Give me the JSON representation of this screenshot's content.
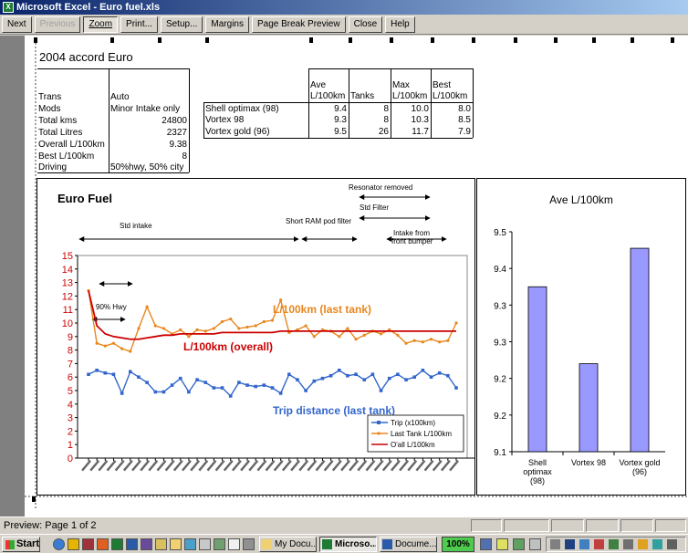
{
  "window": {
    "title": "Microsoft Excel - Euro fuel.xls"
  },
  "toolbar": {
    "next": "Next",
    "previous": "Previous",
    "zoom": "Zoom",
    "print": "Print...",
    "setup": "Setup...",
    "margins": "Margins",
    "page_break": "Page Break Preview",
    "close": "Close",
    "help": "Help"
  },
  "sheet": {
    "title": "2004 accord Euro",
    "info_rows": [
      {
        "label": "Trans",
        "value": "Auto"
      },
      {
        "label": "Mods",
        "value": "Minor Intake only"
      },
      {
        "label": "Total kms",
        "value": "24800"
      },
      {
        "label": "Total Litres",
        "value": "2327"
      },
      {
        "label": "Overall L/100km",
        "value": "9.38"
      },
      {
        "label": "Best L/100km",
        "value": "8"
      },
      {
        "label": "Driving",
        "value": "50%hwy, 50% city"
      }
    ],
    "fuel_table": {
      "headers": {
        "ave_1": "Ave",
        "ave_2": "L/100km",
        "tanks": "Tanks",
        "max_1": "Max",
        "max_2": "L/100km",
        "best_1": "Best",
        "best_2": "L/100km"
      },
      "rows": [
        {
          "name": "Shell optimax (98)",
          "ave": "9.4",
          "tanks": "8",
          "max": "10.0",
          "best": "8.0"
        },
        {
          "name": "Vortex 98",
          "ave": "9.3",
          "tanks": "8",
          "max": "10.3",
          "best": "8.5"
        },
        {
          "name": "Vortex gold (96)",
          "ave": "9.5",
          "tanks": "26",
          "max": "11.7",
          "best": "7.9"
        }
      ]
    }
  },
  "line_chart_labels": {
    "title": "Euro Fuel",
    "resonator": "Resonator removed",
    "std_filter": "Std Filter",
    "std_intake": "Std intake",
    "short_ram": "Short RAM pod filter",
    "intake_bumper_1": "Intake from",
    "intake_bumper_2": "front bumper",
    "hwy": "90% Hwy",
    "last_tank_label": "L/100km (last tank)",
    "overall_label": "L/100km (overall)",
    "trip_label": "Trip distance (last tank)",
    "legend": [
      "Trip (x100km)",
      "Last Tank L/100km",
      "O'all L/100km"
    ]
  },
  "chart_data": [
    {
      "type": "line",
      "title": "Euro Fuel",
      "xlabel": "",
      "ylabel": "",
      "ylim": [
        0,
        15
      ],
      "yticks": [
        0,
        1,
        2,
        3,
        4,
        5,
        6,
        7,
        8,
        9,
        10,
        11,
        12,
        13,
        14,
        15
      ],
      "legend_position": "bottom-right",
      "series": [
        {
          "name": "Trip (x100km)",
          "color": "#3366cc",
          "values": [
            6.2,
            6.5,
            6.3,
            6.2,
            4.8,
            6.4,
            6.0,
            5.6,
            4.9,
            4.9,
            5.4,
            5.9,
            4.9,
            5.8,
            5.6,
            5.2,
            5.2,
            4.6,
            5.6,
            5.4,
            5.3,
            5.4,
            5.2,
            4.8,
            6.2,
            5.8,
            5.0,
            5.7,
            5.9,
            6.1,
            6.5,
            6.1,
            6.2,
            5.8,
            6.2,
            5.0,
            5.9,
            6.2,
            5.8,
            6.0,
            6.5,
            6.0,
            6.3,
            6.1,
            5.2
          ]
        },
        {
          "name": "Last Tank L/100km",
          "color": "#e8871e",
          "values": [
            12.4,
            8.5,
            8.3,
            8.5,
            8.1,
            7.9,
            9.6,
            11.2,
            9.8,
            9.6,
            9.2,
            9.5,
            9.0,
            9.5,
            9.4,
            9.6,
            10.1,
            10.3,
            9.6,
            9.7,
            9.8,
            10.1,
            10.2,
            11.7,
            9.3,
            9.5,
            9.8,
            9.0,
            9.5,
            9.4,
            9.0,
            9.6,
            8.8,
            9.1,
            9.4,
            9.2,
            9.5,
            9.1,
            8.5,
            8.7,
            8.6,
            8.8,
            8.6,
            8.7,
            10.0
          ]
        },
        {
          "name": "O'all L/100km",
          "color": "#cc0000",
          "values": [
            12.4,
            9.8,
            9.2,
            9.0,
            8.9,
            8.8,
            8.8,
            8.9,
            9.0,
            9.1,
            9.1,
            9.2,
            9.2,
            9.2,
            9.2,
            9.2,
            9.3,
            9.3,
            9.3,
            9.3,
            9.3,
            9.3,
            9.3,
            9.4,
            9.4,
            9.4,
            9.4,
            9.4,
            9.4,
            9.4,
            9.4,
            9.4,
            9.4,
            9.4,
            9.4,
            9.4,
            9.4,
            9.4,
            9.4,
            9.4,
            9.4,
            9.4,
            9.4,
            9.4,
            9.4
          ]
        }
      ]
    },
    {
      "type": "bar",
      "title": "Ave L/100km",
      "categories": [
        "Shell optimax (98)",
        "Vortex 98",
        "Vortex gold (96)"
      ],
      "category_lines": [
        [
          "Shell",
          "optimax",
          "(98)"
        ],
        [
          "Vortex 98"
        ],
        [
          "Vortex gold",
          "(96)"
        ]
      ],
      "values": [
        9.4,
        9.3,
        9.5
      ],
      "bar_heights_in_axis_units": [
        9.4,
        9.26,
        9.47
      ],
      "ylim": [
        9.1,
        9.5
      ],
      "ytick_labels": [
        "9.5",
        "9.4",
        "9.3",
        "9.3",
        "9.2",
        "9.2",
        "9.1"
      ],
      "bar_color": "#9999ff"
    }
  ],
  "status": {
    "text": "Preview: Page 1 of 2"
  },
  "taskbar": {
    "start": "Start",
    "tasks": [
      "My Docu...",
      "Microso...",
      "Docume..."
    ],
    "zoom": "100%"
  }
}
